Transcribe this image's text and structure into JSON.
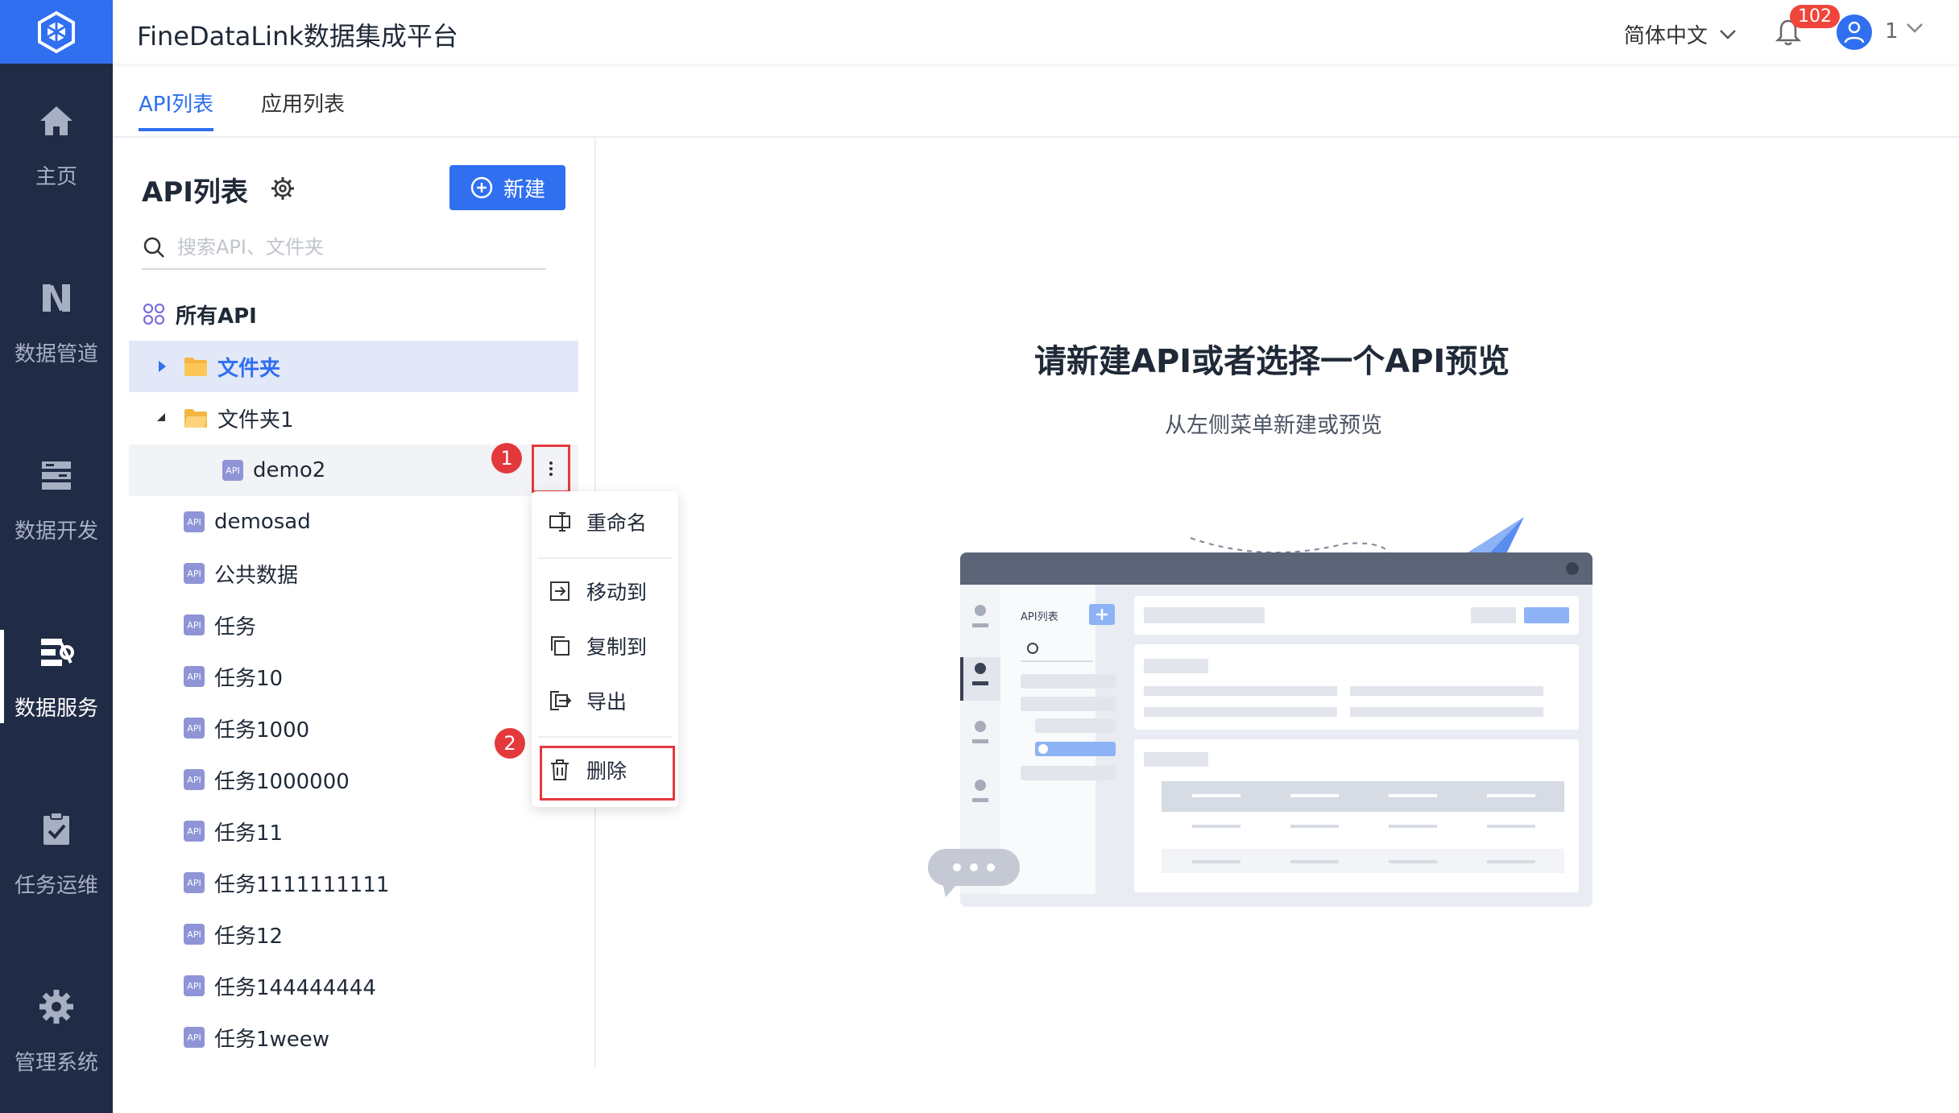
{
  "header": {
    "app_title": "FineDataLink数据集成平台",
    "language": "简体中文",
    "notifications_count": "102",
    "user_name": "1"
  },
  "nav": {
    "items": [
      {
        "label": "主页",
        "icon": "home-icon"
      },
      {
        "label": "数据管道",
        "icon": "pipeline-icon"
      },
      {
        "label": "数据开发",
        "icon": "dev-icon"
      },
      {
        "label": "数据服务",
        "icon": "service-icon"
      },
      {
        "label": "任务运维",
        "icon": "ops-icon"
      },
      {
        "label": "管理系统",
        "icon": "gear-icon"
      }
    ],
    "active": "数据服务"
  },
  "tabs": {
    "api_list": "API列表",
    "app_list": "应用列表"
  },
  "panel": {
    "title": "API列表",
    "new_button": "新建",
    "search_placeholder": "搜索API、文件夹",
    "all_api": "所有API",
    "tree": [
      {
        "label": "文件夹",
        "type": "folder",
        "expanded": false,
        "selected": true
      },
      {
        "label": "文件夹1",
        "type": "folder",
        "expanded": true
      },
      {
        "label": "demo2",
        "type": "api",
        "indent": 2
      },
      {
        "label": "demosad",
        "type": "api"
      },
      {
        "label": "公共数据",
        "type": "api"
      },
      {
        "label": "任务",
        "type": "api"
      },
      {
        "label": "任务10",
        "type": "api"
      },
      {
        "label": "任务1000",
        "type": "api"
      },
      {
        "label": "任务1000000",
        "type": "api"
      },
      {
        "label": "任务11",
        "type": "api"
      },
      {
        "label": "任务1111111111",
        "type": "api"
      },
      {
        "label": "任务12",
        "type": "api"
      },
      {
        "label": "任务144444444",
        "type": "api"
      },
      {
        "label": "任务1weew",
        "type": "api"
      }
    ],
    "api_icon_text": "API"
  },
  "context_menu": {
    "rename": "重命名",
    "move_to": "移动到",
    "copy_to": "复制到",
    "export": "导出",
    "delete": "删除"
  },
  "markers": {
    "step1": "1",
    "step2": "2"
  },
  "empty_state": {
    "title": "请新建API或者选择一个API预览",
    "subtitle": "从左侧菜单新建或预览",
    "illustration_label": "API列表"
  },
  "colors": {
    "nav_bg": "#202b46",
    "accent": "#2f6ff0",
    "highlight_red": "#e4393c",
    "selected_bg": "#e2e8f8"
  }
}
